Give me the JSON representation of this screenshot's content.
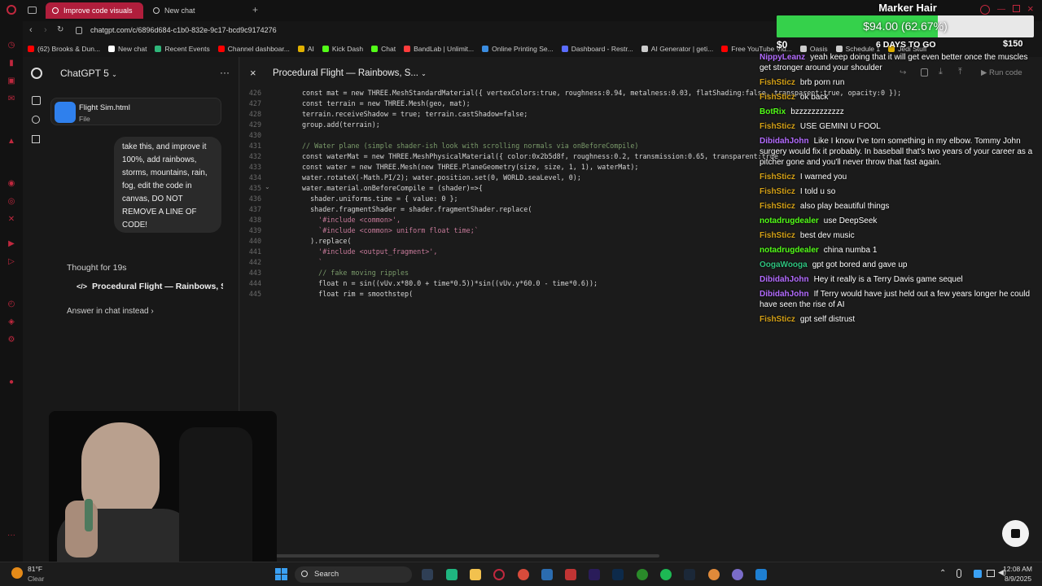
{
  "browser": {
    "tabs": [
      {
        "label": "Improve code visuals",
        "active": true
      },
      {
        "label": "New chat",
        "active": false
      }
    ],
    "url": "chatgpt.com/c/6896d684-c1b0-832e-9c17-bcd9c9174276",
    "bookmarks": [
      {
        "label": "(62) Brooks & Dun...",
        "color": "#ff0000"
      },
      {
        "label": "New chat",
        "color": "#ffffff"
      },
      {
        "label": "Recent Events",
        "color": "#2fb67a"
      },
      {
        "label": "Channel dashboar...",
        "color": "#ff0000"
      },
      {
        "label": "AI",
        "color": "#e0b000"
      },
      {
        "label": "Kick Dash",
        "color": "#53fc18"
      },
      {
        "label": "Chat",
        "color": "#53fc18"
      },
      {
        "label": "BandLab | Unlimit...",
        "color": "#ff3c3c"
      },
      {
        "label": "Online Printing Se...",
        "color": "#3b8de0"
      },
      {
        "label": "Dashboard - Restr...",
        "color": "#5a6cff"
      },
      {
        "label": "AI Generator | geti...",
        "color": "#cccccc"
      },
      {
        "label": "Free YouTube Vid...",
        "color": "#ff0000"
      },
      {
        "label": "Oasis",
        "color": "#cccccc"
      },
      {
        "label": "Schedule 1",
        "color": "#cccccc"
      },
      {
        "label": "Jedi Stuff",
        "color": "#e0b000"
      }
    ]
  },
  "sidebar": {
    "model": "ChatGPT 5",
    "attachment_name": "Flight Sim.html",
    "attachment_type": "File",
    "user_message": "take this, and improve it 100%, add rainbows, storms, mountains, rain, fog, edit the code in canvas, DO NOT REMOVE A LINE OF CODE!",
    "thought": "Thought for 19s",
    "canvas_link": "Procedural Flight — Rainbows, St",
    "answer_link": "Answer in chat instead"
  },
  "canvas": {
    "title": "Procedural Flight — Rainbows, S...",
    "run_label": "Run code",
    "lines": [
      {
        "n": "426",
        "text": "const mat = new THREE.MeshStandardMaterial({ vertexColors:true, roughness:0.94, metalness:0.03, flatShading:false, transparent:true, opacity:0 });"
      },
      {
        "n": "427",
        "text": "const terrain = new THREE.Mesh(geo, mat);"
      },
      {
        "n": "428",
        "text": "terrain.receiveShadow = true; terrain.castShadow=false;"
      },
      {
        "n": "429",
        "text": "group.add(terrain);"
      },
      {
        "n": "430",
        "text": ""
      },
      {
        "n": "431",
        "text": "// Water plane (simple shader-ish look with scrolling normals via onBeforeCompile)"
      },
      {
        "n": "432",
        "text": "const waterMat = new THREE.MeshPhysicalMaterial({ color:0x2b5d8f, roughness:0.2, transmission:0.65, transparent:true"
      },
      {
        "n": "433",
        "text": "const water = new THREE.Mesh(new THREE.PlaneGeometry(size, size, 1, 1), waterMat);"
      },
      {
        "n": "434",
        "text": "water.rotateX(-Math.PI/2); water.position.set(0, WORLD.seaLevel, 0);"
      },
      {
        "n": "435",
        "text": "water.material.onBeforeCompile = (shader)=>{"
      },
      {
        "n": "436",
        "text": "  shader.uniforms.time = { value: 0 };"
      },
      {
        "n": "437",
        "text": "  shader.fragmentShader = shader.fragmentShader.replace("
      },
      {
        "n": "438",
        "text": "    '#include <common>',"
      },
      {
        "n": "439",
        "text": "    `#include <common> uniform float time;`"
      },
      {
        "n": "440",
        "text": "  ).replace("
      },
      {
        "n": "441",
        "text": "    '#include <output_fragment>',"
      },
      {
        "n": "442",
        "text": "    `"
      },
      {
        "n": "443",
        "text": "    // fake moving ripples"
      },
      {
        "n": "444",
        "text": "    float n = sin((vUv.x*80.0 + time*0.5))*sin((vUv.y*60.0 - time*0.6));"
      },
      {
        "n": "445",
        "text": "    float rim = smoothstep("
      }
    ]
  },
  "overlay": {
    "title": "Marker Hair",
    "amount": "$94.00 (62.67%)",
    "progress": 0.6267,
    "min": "$0",
    "max": "$150",
    "countdown": "6 DAYS TO GO"
  },
  "chat": [
    {
      "user": "NippyLeanz",
      "color": "#b36bff",
      "text": "yeah keep doing that it will get even better once the muscles get stronger around your shoulder"
    },
    {
      "user": "FishSticz",
      "color": "#d4a017",
      "text": "brb porn run"
    },
    {
      "user": "FishSticz",
      "color": "#d4a017",
      "text": "ok back"
    },
    {
      "user": "BotRix",
      "color": "#53fc18",
      "text": "bzzzzzzzzzzzz"
    },
    {
      "user": "FishSticz",
      "color": "#d4a017",
      "text": "USE GEMINI U FOOL"
    },
    {
      "user": "DibidahJohn",
      "color": "#b36bff",
      "text": "Like I know I've torn something in my elbow. Tommy John surgery would fix it probably. In baseball that's two years of your career as a pitcher gone and you'll never throw that fast again."
    },
    {
      "user": "FishSticz",
      "color": "#d4a017",
      "text": "I warned you"
    },
    {
      "user": "FishSticz",
      "color": "#d4a017",
      "text": "I told u so"
    },
    {
      "user": "FishSticz",
      "color": "#d4a017",
      "text": "also play beautiful things"
    },
    {
      "user": "notadrugdealer",
      "color": "#53fc18",
      "text": "use DeepSeek"
    },
    {
      "user": "FishSticz",
      "color": "#d4a017",
      "text": "best dev music"
    },
    {
      "user": "notadrugdealer",
      "color": "#53fc18",
      "text": "china numba 1"
    },
    {
      "user": "OogaWooga",
      "color": "#2ec27e",
      "text": "gpt got bored and gave up"
    },
    {
      "user": "DibidahJohn",
      "color": "#b36bff",
      "text": "Hey it really is a Terry Davis game sequel"
    },
    {
      "user": "DibidahJohn",
      "color": "#b36bff",
      "text": "If Terry would have just held out a few years longer he could have seen the rise of AI"
    },
    {
      "user": "FishSticz",
      "color": "#d4a017",
      "text": "gpt self distrust"
    }
  ],
  "taskbar": {
    "weather_temp": "81°F",
    "weather_desc": "Clear",
    "search_label": "Search",
    "time": "12:08 AM",
    "date": "8/9/2025"
  }
}
